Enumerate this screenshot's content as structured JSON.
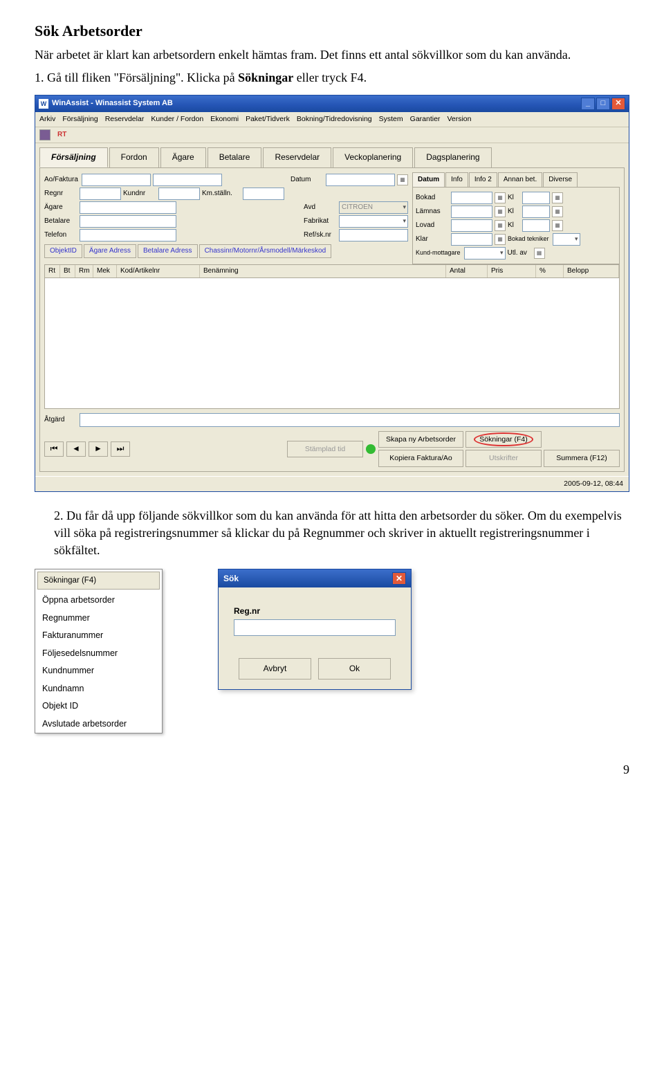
{
  "doc": {
    "heading": "Sök Arbetsorder",
    "intro": "När arbetet är klart kan arbetsordern enkelt hämtas fram. Det finns ett antal sökvillkor som du kan använda.",
    "step1_prefix": "1.  Gå till fliken \"Försäljning\". Klicka på ",
    "step1_bold": "Sökningar",
    "step1_suffix": " eller tryck F4.",
    "step2": "2.  Du får då upp följande sökvillkor som du kan använda för att hitta den arbetsorder du söker. Om du exempelvis vill söka på registreringsnummer så klickar du på Regnummer och skriver in aktuellt registreringsnummer i sökfältet.",
    "page_number": "9"
  },
  "app": {
    "title": "WinAssist - Winassist System AB",
    "menus": [
      "Arkiv",
      "Försäljning",
      "Reservdelar",
      "Kunder / Fordon",
      "Ekonomi",
      "Paket/Tidverk",
      "Bokning/Tidredovisning",
      "System",
      "Garantier",
      "Version"
    ],
    "tool_label": "RT",
    "main_tabs": [
      "Försäljning",
      "Fordon",
      "Ägare",
      "Betalare",
      "Reservdelar",
      "Veckoplanering",
      "Dagsplanering"
    ],
    "sub_tabs": [
      "Datum",
      "Info",
      "Info 2",
      "Annan bet.",
      "Diverse"
    ],
    "fields_left": {
      "aofaktura": "Ao/Faktura",
      "datum": "Datum",
      "regnr": "Regnr",
      "kundnr": "Kundnr",
      "kmstalln": "Km.ställn.",
      "agare": "Ägare",
      "avd": "Avd",
      "avd_value": "CITROEN",
      "betalare": "Betalare",
      "fabrikat": "Fabrikat",
      "telefon": "Telefon",
      "refsknr": "Ref/sk.nr"
    },
    "fields_right": {
      "bokad": "Bokad",
      "kl": "Kl",
      "lamnas": "Lämnas",
      "lovad": "Lovad",
      "klar": "Klar",
      "bokad_tekniker": "Bokad tekniker",
      "kundmottagare": "Kund-mottagare",
      "utlav": "Utl. av"
    },
    "hdr_btns": [
      "ObjektID",
      "Ägare Adress",
      "Betalare Adress",
      "Chassinr/Motornr/Årsmodell/Märkeskod"
    ],
    "list_cols": [
      "Rt",
      "Bt",
      "Rm",
      "Mek",
      "Kod/Artikelnr",
      "Benämning",
      "Antal",
      "Pris",
      "%",
      "Belopp"
    ],
    "atgard": "Åtgärd",
    "buttons": {
      "stamplad": "Stämplad tid",
      "skapa": "Skapa ny Arbetsorder",
      "sokningar": "Sökningar (F4)",
      "kopiera": "Kopiera Faktura/Ao",
      "utskrifter": "Utskrifter",
      "summera": "Summera (F12)"
    },
    "status": "2005-09-12, 08:44"
  },
  "menu_popup": {
    "head": "Sökningar (F4)",
    "items": [
      "Öppna arbetsorder",
      "Regnummer",
      "Fakturanummer",
      "Följesedelsnummer",
      "Kundnummer",
      "Kundnamn",
      "Objekt ID",
      "Avslutade arbetsorder"
    ]
  },
  "sok": {
    "title": "Sök",
    "label": "Reg.nr",
    "cancel": "Avbryt",
    "ok": "Ok"
  }
}
